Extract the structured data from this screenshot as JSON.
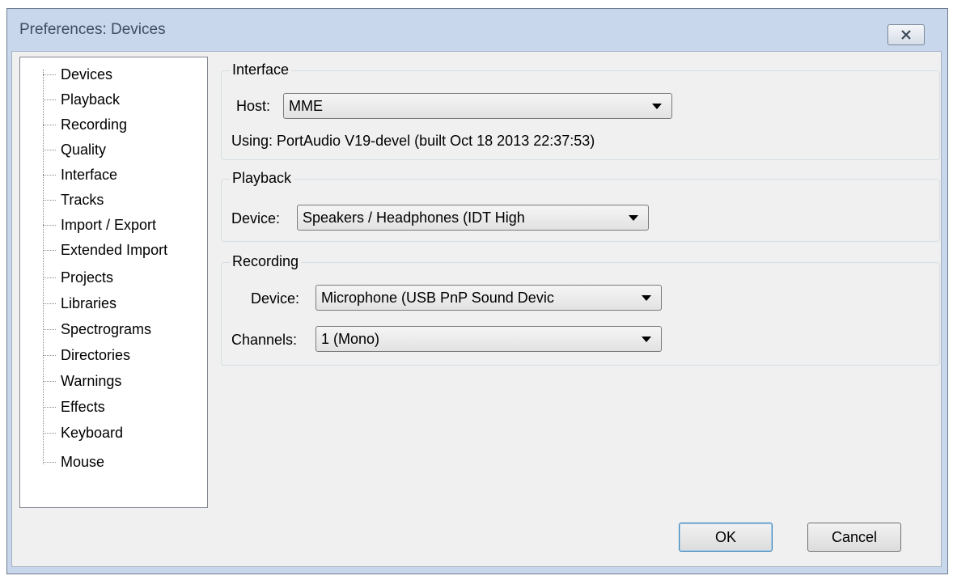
{
  "window": {
    "title": "Preferences: Devices"
  },
  "tree": {
    "items": [
      "Devices",
      "Playback",
      "Recording",
      "Quality",
      "Interface",
      "Tracks",
      "Import / Export",
      "Extended Import",
      "Projects",
      "Libraries",
      "Spectrograms",
      "Directories",
      "Warnings",
      "Effects",
      "Keyboard",
      "Mouse"
    ],
    "selected": "Devices"
  },
  "interface": {
    "group_label": "Interface",
    "host_label": "Host:",
    "host_value": "MME",
    "using_text": "Using: PortAudio V19-devel (built Oct 18 2013 22:37:53)"
  },
  "playback": {
    "group_label": "Playback",
    "device_label": "Device:",
    "device_value": "Speakers / Headphones (IDT High"
  },
  "recording": {
    "group_label": "Recording",
    "device_label": "Device:",
    "device_value": "Microphone (USB PnP Sound Devic",
    "channels_label": "Channels:",
    "channels_value": "1 (Mono)"
  },
  "buttons": {
    "ok": "OK",
    "cancel": "Cancel"
  }
}
